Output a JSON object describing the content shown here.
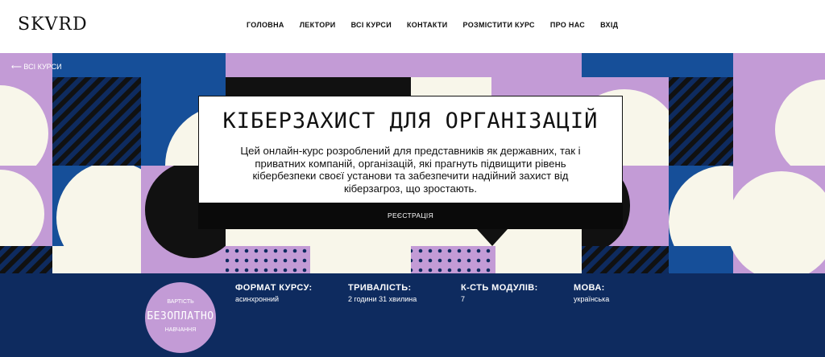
{
  "header": {
    "logo": "SKVRD",
    "nav": [
      "ГОЛОВНА",
      "ЛЕКТОРИ",
      "ВСІ КУРСИ",
      "КОНТАКТИ",
      "РОЗМІСТИТИ КУРС",
      "ПРО НАС",
      "ВХІД"
    ]
  },
  "hero": {
    "back_link": "⟵ ВСІ КУРСИ",
    "title": "КІБЕРЗАХИСТ ДЛЯ ОРГАНІЗАЦІЙ",
    "description": "Цей онлайн-курс розроблений для представників як державних, так і приватних компаній, організацій, які прагнуть підвищити рівень кібербезпеки своєї установи та забезпечити надійний захист від кіберзагроз, що зростають.",
    "register_label": "РЕЄСТРАЦІЯ"
  },
  "info": {
    "price_top": "ВАРТІСТЬ",
    "price_main": "БЕЗОПЛАТНО",
    "price_bottom": "НАВЧАННЯ",
    "facts": [
      {
        "label": "ФОРМАТ КУРСУ:",
        "value": "асинхронний"
      },
      {
        "label": "ТРИВАЛІСТЬ:",
        "value": "2 години 31 хвилина"
      },
      {
        "label": "К-СТЬ МОДУЛІВ:",
        "value": "7"
      },
      {
        "label": "МОВА:",
        "value": "українська"
      }
    ]
  },
  "colors": {
    "navy": "#0e2b5f",
    "blue": "#164f99",
    "lilac": "#c39bd6",
    "cream": "#f8f6ea",
    "black": "#0a0a0a"
  }
}
